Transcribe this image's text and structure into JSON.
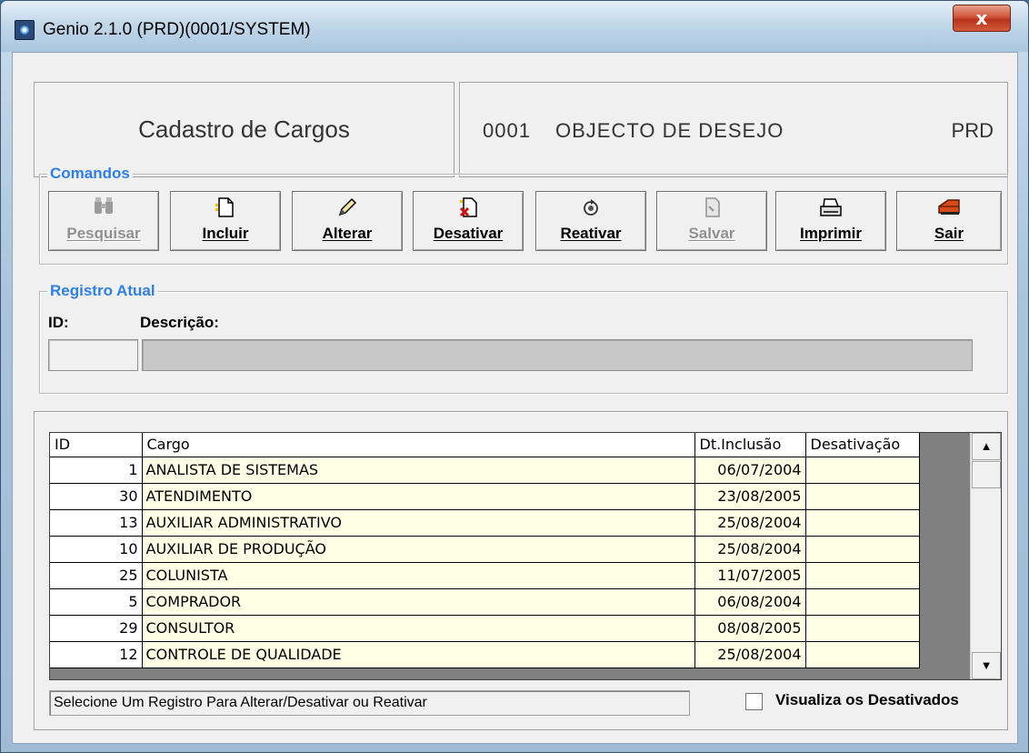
{
  "window": {
    "title": "Genio 2.1.0 (PRD)(0001/SYSTEM)",
    "close_label": "x"
  },
  "header": {
    "screen_title": "Cadastro de Cargos",
    "company_code": "0001",
    "company_name": "OBJECTO DE DESEJO",
    "environment": "PRD"
  },
  "commands": {
    "group_title": "Comandos",
    "buttons": [
      {
        "label": "Pesquisar",
        "icon": "binoculars-icon",
        "enabled": false
      },
      {
        "label": "Incluir",
        "icon": "new-document-icon",
        "enabled": true
      },
      {
        "label": "Alterar",
        "icon": "pencil-icon",
        "enabled": true
      },
      {
        "label": "Desativar",
        "icon": "delete-document-icon",
        "enabled": true
      },
      {
        "label": "Reativar",
        "icon": "reactivate-icon",
        "enabled": true
      },
      {
        "label": "Salvar",
        "icon": "save-icon",
        "enabled": false
      },
      {
        "label": "Imprimir",
        "icon": "printer-icon",
        "enabled": true
      },
      {
        "label": "Sair",
        "icon": "exit-icon",
        "enabled": true
      }
    ]
  },
  "registro": {
    "group_title": "Registro Atual",
    "id_label": "ID:",
    "desc_label": "Descrição:",
    "id_value": "",
    "desc_value": ""
  },
  "grid": {
    "columns": [
      "ID",
      "Cargo",
      "Dt.Inclusão",
      "Desativação"
    ],
    "rows": [
      {
        "id": "1",
        "cargo": "ANALISTA DE SISTEMAS",
        "inclusao": "06/07/2004",
        "desativacao": ""
      },
      {
        "id": "30",
        "cargo": "ATENDIMENTO",
        "inclusao": "23/08/2005",
        "desativacao": ""
      },
      {
        "id": "13",
        "cargo": "AUXILIAR ADMINISTRATIVO",
        "inclusao": "25/08/2004",
        "desativacao": ""
      },
      {
        "id": "10",
        "cargo": "AUXILIAR DE PRODUÇÃO",
        "inclusao": "25/08/2004",
        "desativacao": ""
      },
      {
        "id": "25",
        "cargo": "COLUNISTA",
        "inclusao": "11/07/2005",
        "desativacao": ""
      },
      {
        "id": "5",
        "cargo": "COMPRADOR",
        "inclusao": "06/08/2004",
        "desativacao": ""
      },
      {
        "id": "29",
        "cargo": "CONSULTOR",
        "inclusao": "08/08/2005",
        "desativacao": ""
      },
      {
        "id": "12",
        "cargo": "CONTROLE DE QUALIDADE",
        "inclusao": "25/08/2004",
        "desativacao": ""
      }
    ]
  },
  "status_text": "Selecione Um Registro Para Alterar/Desativar ou Reativar",
  "show_deactivated": {
    "label": "Visualiza os Desativados",
    "checked": false
  },
  "colors": {
    "group_title": "#2e7fe6",
    "grid_row_bg": "#ffffe6",
    "close_button": "#c8432a"
  }
}
